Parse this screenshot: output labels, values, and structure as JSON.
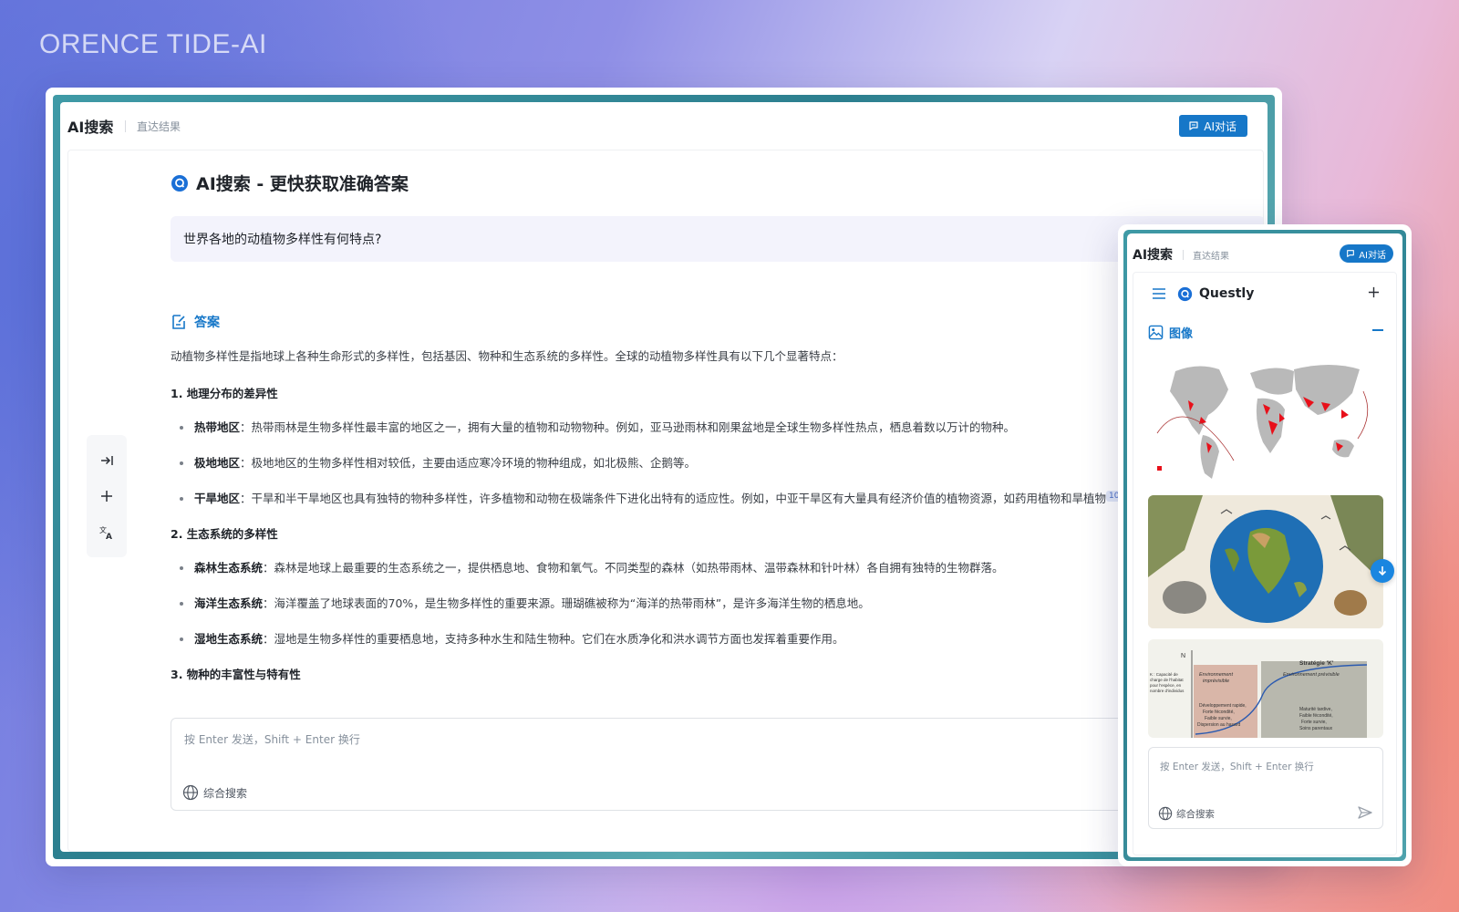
{
  "brand": "ORENCE TIDE-AI",
  "desktop": {
    "app_title": "AI搜索",
    "app_subtitle": "直达结果",
    "ai_chat_label": "AI对话",
    "page_title": "AI搜索 - 更快获取准确答案",
    "query": "世界各地的动植物多样性有何特点?",
    "answer_heading": "答案",
    "intro": "动植物多样性是指地球上各种生命形式的多样性，包括基因、物种和生态系统的多样性。全球的动植物多样性具有以下几个显著特点：",
    "sections": [
      {
        "title": "1. 地理分布的差异性",
        "items": [
          {
            "term": "热带地区",
            "text": "：热带雨林是生物多样性最丰富的地区之一，拥有大量的植物和动物物种。例如，亚马逊雨林和刚果盆地是全球生物多样性热点，栖息着数以万计的物种。"
          },
          {
            "term": "极地地区",
            "text": "：极地地区的生物多样性相对较低，主要由适应寒冷环境的物种组成，如北极熊、企鹅等。"
          },
          {
            "term": "干旱地区",
            "text": "：干旱和半干旱地区也具有独特的物种多样性，许多植物和动物在极端条件下进化出特有的适应性。例如，中亚干旱区有大量具有经济价值的植物资源，如药用植物和旱植物",
            "cite": "10",
            "tail": "。"
          }
        ]
      },
      {
        "title": "2. 生态系统的多样性",
        "items": [
          {
            "term": "森林生态系统",
            "text": "：森林是地球上最重要的生态系统之一，提供栖息地、食物和氧气。不同类型的森林（如热带雨林、温带森林和针叶林）各自拥有独特的生物群落。"
          },
          {
            "term": "海洋生态系统",
            "text": "：海洋覆盖了地球表面的70%，是生物多样性的重要来源。珊瑚礁被称为“海洋的热带雨林”，是许多海洋生物的栖息地。"
          },
          {
            "term": "湿地生态系统",
            "text": "：湿地是生物多样性的重要栖息地，支持多种水生和陆生物种。它们在水质净化和洪水调节方面也发挥着重要作用。"
          }
        ]
      },
      {
        "title": "3. 物种的丰富性与特有性",
        "items": []
      }
    ],
    "composer_placeholder": "按 Enter 发送，Shift + Enter 换行",
    "search_mode": "综合搜索"
  },
  "mobile": {
    "app_title": "AI搜索",
    "app_subtitle": "直达结果",
    "ai_chat_label": "AI对话",
    "app_name": "Questly",
    "section_label": "图像",
    "chart_labels": {
      "y_axis": "N",
      "strategy": "Stratégie 'K'",
      "k_note": [
        "K : Capacité de",
        "charge de l'habitat",
        "pour l'espèce, en",
        "nombre d'individus"
      ],
      "env_left": [
        "Environnement",
        "imprévisible"
      ],
      "env_right": "Environnement prévisible",
      "left_traits": [
        "Développement rapide,",
        "Forte fécondité,",
        "Faible survie,",
        "Dispersion au hasard"
      ],
      "right_traits": [
        "Maturité tardive,",
        "Faible fécondité,",
        "Forte survie,",
        "Soins parentaux"
      ]
    },
    "composer_placeholder": "按 Enter 发送，Shift + Enter 换行",
    "search_mode": "综合搜索"
  },
  "colors": {
    "accent": "#1677c8",
    "query_bg": "#f3f3fc",
    "frame_teal": "#2c7f8f",
    "map_highlight": "#e8101a"
  },
  "icons": {
    "logo": "search-logo-icon",
    "answer": "edit-note-icon",
    "collapse_sidebar": "arrow-to-right-icon",
    "new": "plus-icon",
    "translate": "translate-icon",
    "globe": "globe-icon",
    "menu": "hamburger-menu-icon",
    "image": "image-gallery-icon",
    "send": "send-icon",
    "scroll": "arrow-down-icon",
    "chat": "chat-bubble-icon"
  }
}
